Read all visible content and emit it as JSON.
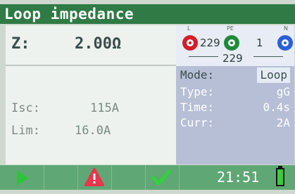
{
  "title": "Loop impedance",
  "main": {
    "z_label": "Z:",
    "z_value": "2.00Ω",
    "isc_label": "Isc:",
    "isc_value": "115A",
    "lim_label": "Lim:",
    "lim_value": "16.0A"
  },
  "terminals": {
    "l_label": "L",
    "pe_label": "PE",
    "n_label": "N",
    "l_pe": "229",
    "pe_n": "1",
    "l_n": "229",
    "colors": {
      "l": "#d21f2b",
      "pe": "#1e8a3a",
      "n": "#2a5fd8"
    }
  },
  "params": {
    "mode_label": "Mode:",
    "mode_value": "Loop",
    "type_label": "Type:",
    "type_value": "gG",
    "time_label": "Time:",
    "time_value": "0.4s",
    "curr_label": "Curr:",
    "curr_value": "2A"
  },
  "bottom": {
    "icons": [
      "play-icon",
      "warning-icon",
      "check-icon",
      "battery-icon"
    ],
    "time": "21:51"
  },
  "colors": {
    "titlebar": "#2f7a45",
    "bottombar": "#5fa774",
    "accent_red": "#e8364e"
  }
}
